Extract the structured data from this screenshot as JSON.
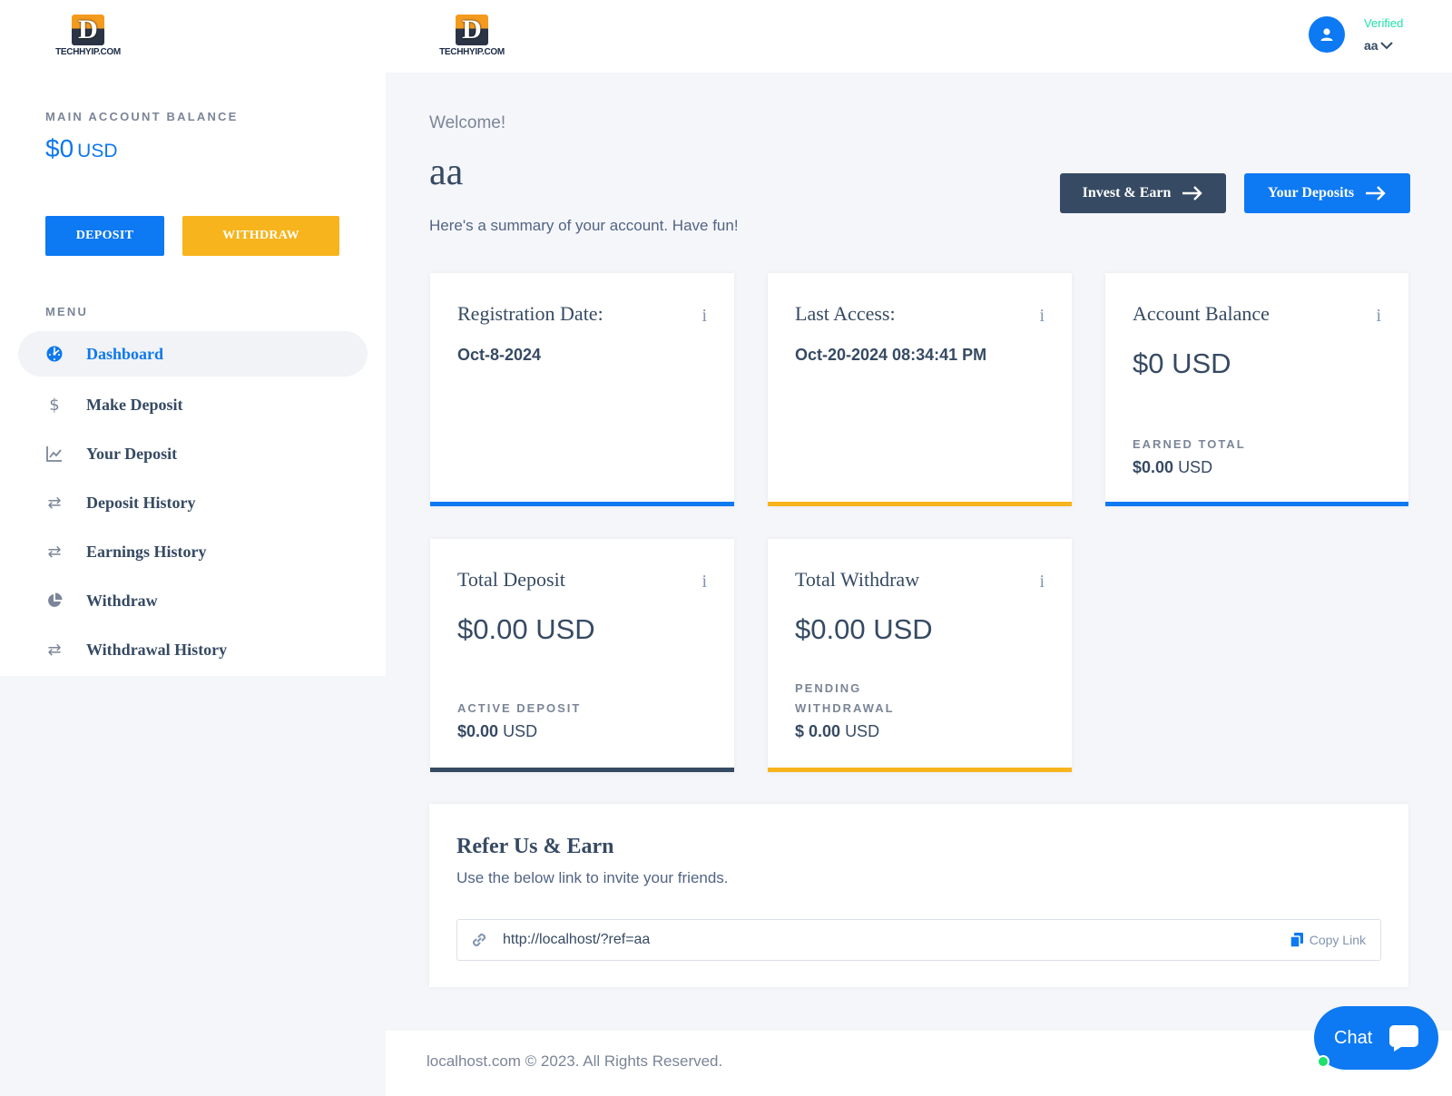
{
  "brand": {
    "logo_letter": "D",
    "logo_text": "TECHHYIP.COM"
  },
  "sidebar": {
    "balance_label": "MAIN ACCOUNT BALANCE",
    "balance_amount": "$0",
    "balance_unit": "USD",
    "deposit_button": "DEPOSIT",
    "withdraw_button": "WITHDRAW",
    "menu_label": "MENU",
    "items": [
      {
        "label": "Dashboard",
        "icon": "dashboard-icon",
        "active": true
      },
      {
        "label": "Make Deposit",
        "icon": "dollar-icon",
        "active": false
      },
      {
        "label": "Your Deposit",
        "icon": "line-chart-icon",
        "active": false
      },
      {
        "label": "Deposit History",
        "icon": "exchange-icon",
        "active": false
      },
      {
        "label": "Earnings History",
        "icon": "exchange-icon",
        "active": false
      },
      {
        "label": "Withdraw",
        "icon": "pie-chart-icon",
        "active": false
      },
      {
        "label": "Withdrawal History",
        "icon": "exchange-icon",
        "active": false
      }
    ]
  },
  "header": {
    "user_status": "Verified",
    "user_name": "aa"
  },
  "main": {
    "welcome": "Welcome!",
    "username": "aa",
    "summary": "Here's a summary of your account. Have fun!",
    "invest_button": "Invest & Earn",
    "deposits_button": "Your Deposits"
  },
  "cards": {
    "registration": {
      "title": "Registration Date:",
      "info": "i",
      "value": "Oct-8-2024"
    },
    "last_access": {
      "title": "Last Access:",
      "info": "i",
      "value": "Oct-20-2024 08:34:41 PM"
    },
    "account_balance": {
      "title": "Account Balance",
      "info": "i",
      "value": "$0 USD",
      "sub_label": "EARNED TOTAL",
      "sub_value": "$0.00",
      "sub_unit": "USD"
    },
    "total_deposit": {
      "title": "Total Deposit",
      "info": "i",
      "value": "$0.00 USD",
      "sub_label": "ACTIVE DEPOSIT",
      "sub_value": "$0.00",
      "sub_unit": "USD"
    },
    "total_withdraw": {
      "title": "Total Withdraw",
      "info": "i",
      "value": "$0.00 USD",
      "sub_label_1": "PENDING",
      "sub_label_2": "WITHDRAWAL",
      "sub_value": "$ 0.00",
      "sub_unit": "USD"
    }
  },
  "refer": {
    "title": "Refer Us & Earn",
    "description": "Use the below link to invite your friends.",
    "link": "http://localhost/?ref=aa",
    "copy_label": "Copy Link"
  },
  "footer": {
    "text": "localhost.com © 2023. All Rights Reserved."
  },
  "chat": {
    "label": "Chat"
  },
  "colors": {
    "primary": "#0d79f2",
    "warning": "#f7b41c",
    "dark": "#364a63",
    "success": "#1ee0ac"
  }
}
